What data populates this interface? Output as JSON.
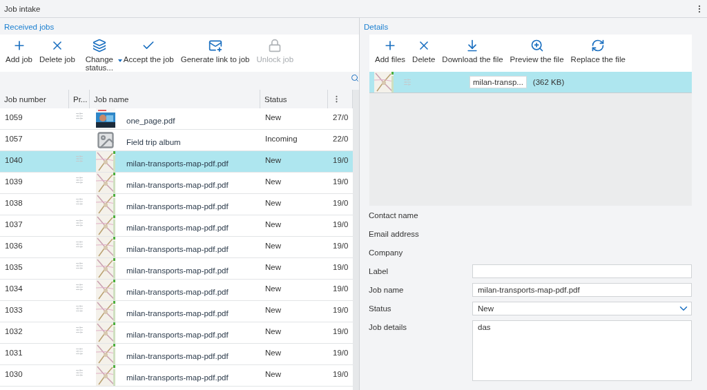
{
  "window": {
    "title": "Job intake"
  },
  "received_jobs": {
    "title": "Received jobs",
    "toolbar": [
      {
        "label": "Add job",
        "kind": "plus",
        "disabled": false,
        "dropdown": false
      },
      {
        "label": "Delete job",
        "kind": "cross",
        "disabled": false,
        "dropdown": false
      },
      {
        "label": "Change status...",
        "kind": "layers",
        "disabled": false,
        "dropdown": true
      },
      {
        "label": "Accept the job",
        "kind": "check",
        "disabled": false,
        "dropdown": false
      },
      {
        "label": "Generate link to job",
        "kind": "mail",
        "disabled": false,
        "dropdown": false
      },
      {
        "label": "Unlock job",
        "kind": "lock",
        "disabled": true,
        "dropdown": false
      }
    ],
    "table": {
      "columns": [
        "Job number",
        "Pr...",
        "Job name",
        "Status"
      ],
      "rows": [
        {
          "number": "1059",
          "flag": true,
          "name": "one_page.pdf",
          "status": "New",
          "date": "27/0",
          "selected": false
        },
        {
          "number": "1057",
          "flag": false,
          "kind": "placeholder",
          "name": "Field trip album",
          "status": "Incoming",
          "date": "22/0",
          "selected": false
        },
        {
          "number": "1040",
          "flag": true,
          "kind": "map",
          "name": "milan-transports-map-pdf.pdf",
          "status": "New",
          "date": "19/0",
          "selected": true
        },
        {
          "number": "1039",
          "flag": true,
          "kind": "map",
          "name": "milan-transports-map-pdf.pdf",
          "status": "New",
          "date": "19/0",
          "selected": false
        },
        {
          "number": "1038",
          "flag": true,
          "kind": "map",
          "name": "milan-transports-map-pdf.pdf",
          "status": "New",
          "date": "19/0",
          "selected": false
        },
        {
          "number": "1037",
          "flag": true,
          "kind": "map",
          "name": "milan-transports-map-pdf.pdf",
          "status": "New",
          "date": "19/0",
          "selected": false
        },
        {
          "number": "1036",
          "flag": true,
          "kind": "map",
          "name": "milan-transports-map-pdf.pdf",
          "status": "New",
          "date": "19/0",
          "selected": false
        },
        {
          "number": "1035",
          "flag": true,
          "kind": "map",
          "name": "milan-transports-map-pdf.pdf",
          "status": "New",
          "date": "19/0",
          "selected": false
        },
        {
          "number": "1034",
          "flag": true,
          "kind": "map",
          "name": "milan-transports-map-pdf.pdf",
          "status": "New",
          "date": "19/0",
          "selected": false
        },
        {
          "number": "1033",
          "flag": true,
          "kind": "map",
          "name": "milan-transports-map-pdf.pdf",
          "status": "New",
          "date": "19/0",
          "selected": false
        },
        {
          "number": "1032",
          "flag": true,
          "kind": "map",
          "name": "milan-transports-map-pdf.pdf",
          "status": "New",
          "date": "19/0",
          "selected": false
        },
        {
          "number": "1031",
          "flag": true,
          "kind": "map",
          "name": "milan-transports-map-pdf.pdf",
          "status": "New",
          "date": "19/0",
          "selected": false
        },
        {
          "number": "1030",
          "flag": true,
          "kind": "map",
          "name": "milan-transports-map-pdf.pdf",
          "status": "New",
          "date": "19/0",
          "selected": false
        }
      ]
    }
  },
  "details": {
    "title": "Details",
    "toolbar": [
      {
        "label": "Add files",
        "kind": "plus"
      },
      {
        "label": "Delete",
        "kind": "cross"
      },
      {
        "label": "Download the file",
        "kind": "download"
      },
      {
        "label": "Preview the file",
        "kind": "preview"
      },
      {
        "label": "Replace the file",
        "kind": "replace"
      }
    ],
    "file": {
      "name": "milan-transp...",
      "size": "(362 KB)",
      "selected": true
    },
    "fields": [
      {
        "label": "Contact name",
        "kind": "text"
      },
      {
        "label": "Email address",
        "kind": "text"
      },
      {
        "label": "Company",
        "kind": "text"
      },
      {
        "label": "Label",
        "kind": "input"
      },
      {
        "label": "Job name",
        "kind": "input",
        "value": "milan-transports-map-pdf.pdf"
      },
      {
        "label": "Status",
        "kind": "select",
        "value": "New"
      },
      {
        "label": "Job details",
        "kind": "textarea",
        "value": "das"
      }
    ]
  }
}
